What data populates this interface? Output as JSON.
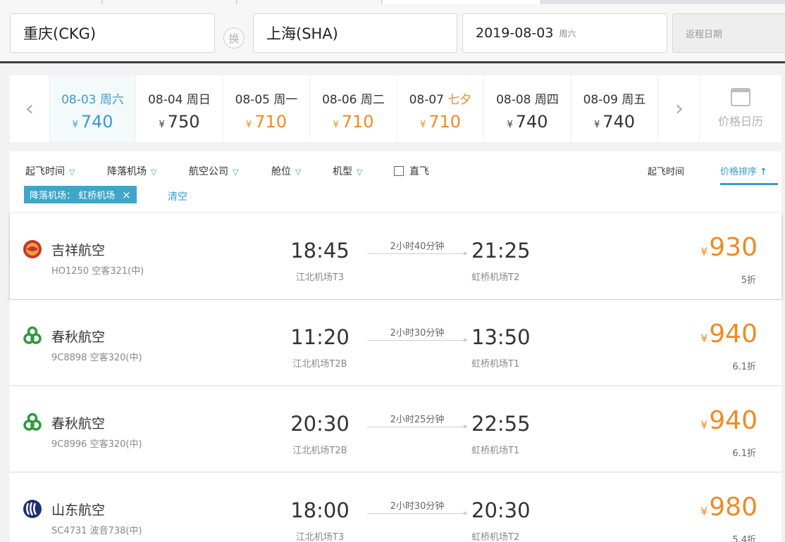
{
  "search": {
    "from": "重庆(CKG)",
    "swap_label": "换",
    "to": "上海(SHA)",
    "depart_date": "2019-08-03",
    "depart_weekday": "周六",
    "return_placeholder": "返程日期"
  },
  "dates": [
    {
      "date": "08-03",
      "weekday": "周六",
      "price": "740",
      "state": "selected"
    },
    {
      "date": "08-04",
      "weekday": "周日",
      "price": "750",
      "state": "normal"
    },
    {
      "date": "08-05",
      "weekday": "周一",
      "price": "710",
      "state": "low"
    },
    {
      "date": "08-06",
      "weekday": "周二",
      "price": "710",
      "state": "low"
    },
    {
      "date": "08-07",
      "weekday": "七夕",
      "price": "710",
      "state": "low-holiday"
    },
    {
      "date": "08-08",
      "weekday": "周四",
      "price": "740",
      "state": "normal"
    },
    {
      "date": "08-09",
      "weekday": "周五",
      "price": "740",
      "state": "normal"
    }
  ],
  "currency": "¥",
  "calendar_label": "价格日历",
  "filters": {
    "items": [
      "起飞时间",
      "降落机场",
      "航空公司",
      "舱位",
      "机型"
    ],
    "direct_label": "直飞",
    "sort_time": "起飞时间",
    "sort_price": "价格排序",
    "active_tag": "降落机场： 虹桥机场",
    "tag_close": "×",
    "clear_label": "清空"
  },
  "flights": [
    {
      "airline": "吉祥航空",
      "flight": "HO1250 空客321(中)",
      "dep_time": "18:45",
      "dep_airport": "江北机场T3",
      "duration": "2小时40分钟",
      "arr_time": "21:25",
      "arr_airport": "虹桥机场T2",
      "price": "930",
      "discount": "5折",
      "logo": "juneyao-logo-icon"
    },
    {
      "airline": "春秋航空",
      "flight": "9C8898 空客320(中)",
      "dep_time": "11:20",
      "dep_airport": "江北机场T2B",
      "duration": "2小时30分钟",
      "arr_time": "13:50",
      "arr_airport": "虹桥机场T1",
      "price": "940",
      "discount": "6.1折",
      "logo": "spring-logo-icon"
    },
    {
      "airline": "春秋航空",
      "flight": "9C8996 空客320(中)",
      "dep_time": "20:30",
      "dep_airport": "江北机场T2B",
      "duration": "2小时25分钟",
      "arr_time": "22:55",
      "arr_airport": "虹桥机场T1",
      "price": "940",
      "discount": "6.1折",
      "logo": "spring-logo-icon"
    },
    {
      "airline": "山东航空",
      "flight": "SC4731 波音738(中)",
      "dep_time": "18:00",
      "dep_airport": "江北机场T3",
      "duration": "2小时30分钟",
      "arr_time": "20:30",
      "arr_airport": "虹桥机场T2",
      "price": "980",
      "discount": "5.4折",
      "logo": "shandong-logo-icon"
    }
  ],
  "colors": {
    "accent": "#3a9bd0",
    "price": "#f08a23",
    "tag": "#3fa5c9"
  }
}
